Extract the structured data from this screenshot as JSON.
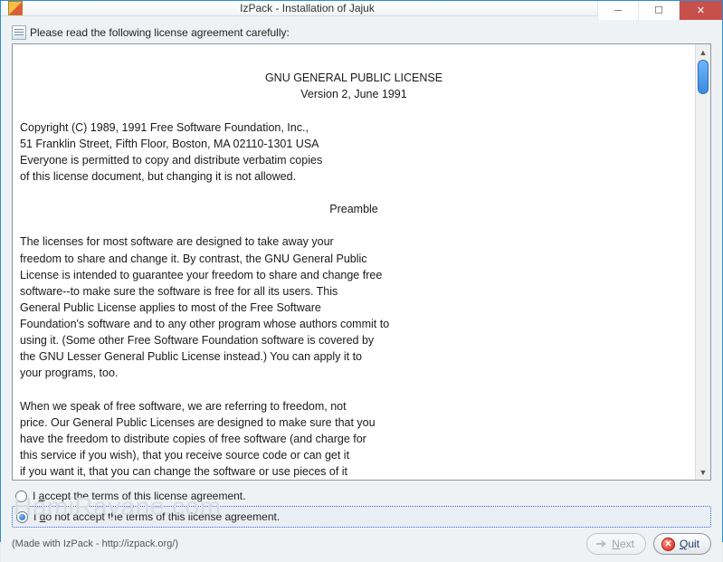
{
  "window": {
    "title": "IzPack - Installation of Jajuk"
  },
  "instruction": "Please read the following license agreement carefully:",
  "license": {
    "title": "GNU GENERAL PUBLIC LICENSE",
    "version_line": "Version 2, June 1991",
    "copyright_block": "Copyright (C) 1989, 1991 Free Software Foundation, Inc.,\n51 Franklin Street, Fifth Floor, Boston, MA 02110-1301 USA\nEveryone is permitted to copy and distribute verbatim copies\nof this license document, but changing it is not allowed.",
    "preamble_heading": "Preamble",
    "preamble_p1": "  The licenses for most software are designed to take away your\nfreedom to share and change it.  By contrast, the GNU General Public\nLicense is intended to guarantee your freedom to share and change free\nsoftware--to make sure the software is free for all its users.  This\nGeneral Public License applies to most of the Free Software\nFoundation's software and to any other program whose authors commit to\nusing it.  (Some other Free Software Foundation software is covered by\nthe GNU Lesser General Public License instead.)  You can apply it to\nyour programs, too.",
    "preamble_p2": "  When we speak of free software, we are referring to freedom, not\nprice.  Our General Public Licenses are designed to make sure that you\nhave the freedom to distribute copies of free software (and charge for\nthis service if you wish), that you receive source code or can get it\nif you want it, that you can change the software or use pieces of it"
  },
  "radios": {
    "accept": {
      "label_pre": "I ",
      "mn": "a",
      "label_post": "ccept the terms of this license agreement.",
      "checked": false
    },
    "reject": {
      "label_pre": "I ",
      "mn": "d",
      "label_post": "o not accept the terms of this license agreement.",
      "checked": true
    }
  },
  "footer": {
    "made_with": "(Made with IzPack - http://izpack.org/)"
  },
  "buttons": {
    "next": {
      "label": "Next",
      "mn": "N",
      "enabled": false
    },
    "quit": {
      "label": "Quit",
      "mn": "Q",
      "enabled": true
    }
  },
  "watermark": "HamiRayane.com"
}
